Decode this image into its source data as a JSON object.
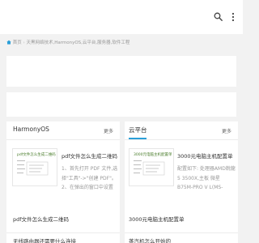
{
  "header": {},
  "breadcrumb": {
    "home": "首页",
    "sep": "›",
    "category": "天黑网络技术,HarmonyOS,云平台,服务器,软件工程"
  },
  "sections": [
    {
      "title": "HarmonyOS",
      "more": "更多",
      "featured": {
        "thumb_title": "pdf文件怎么生成二维码",
        "title": "pdf文件怎么生成二维码",
        "desc": "1、首先打开 PDF 文件,选择\"工具\"->\"创建 PDF\"。2、在弹出的窗口中设置"
      },
      "items": [
        "pdf文件怎么生成二维码",
        "无线路由器还需要什么连接"
      ]
    },
    {
      "title": "云平台",
      "more": "更多",
      "featured": {
        "thumb_title": "3000元电脑主机配置单",
        "title": "3000元电脑主机配置单",
        "desc": "配置如下: 处理器AMD銳龍5 3500X,主板 微星 B75M-PRO V L(MS-"
      },
      "items": [
        "3000元电脑主机配置单",
        "蒸汽机怎么开始的"
      ]
    }
  ]
}
